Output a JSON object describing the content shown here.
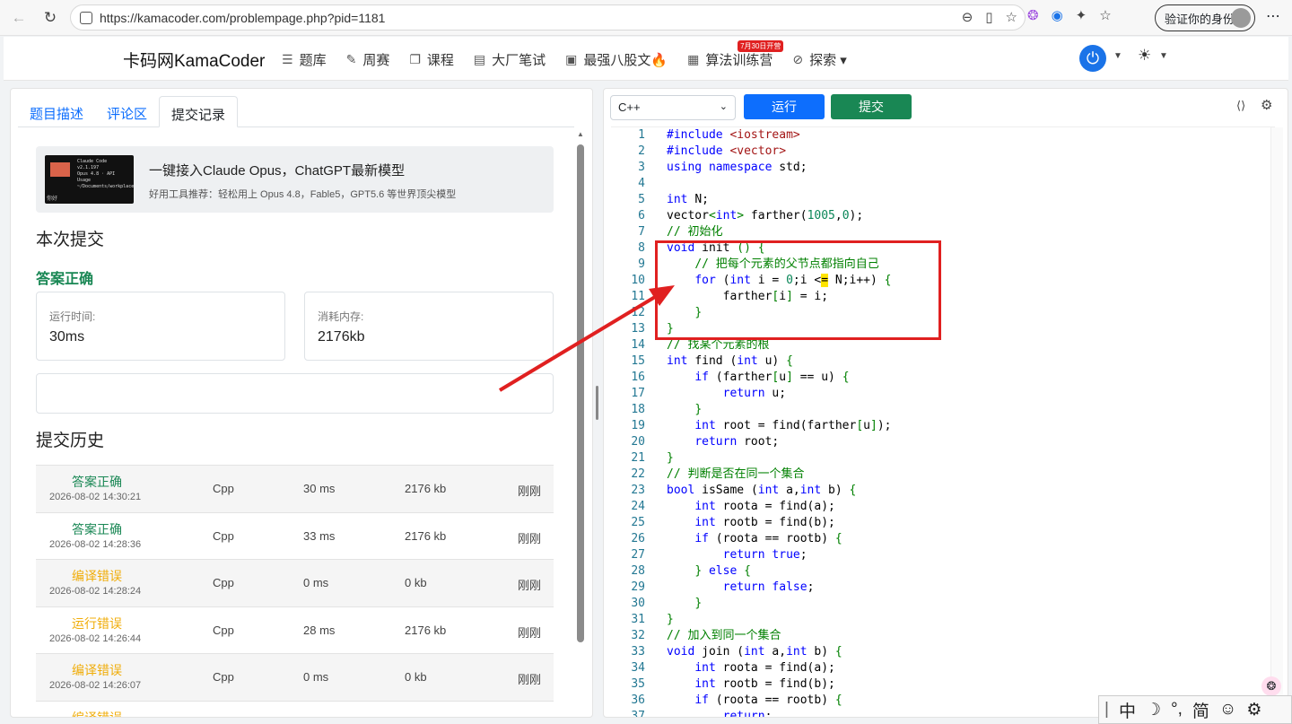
{
  "browser": {
    "url": "https://kamacoder.com/problempage.php?pid=1181",
    "profile_label": "验证你的身份"
  },
  "site": {
    "brand": "卡码网KamaCoder",
    "nav": [
      {
        "icon": "list-icon",
        "glyph": "☰",
        "label": "题库"
      },
      {
        "icon": "pencil-icon",
        "glyph": "✎",
        "label": "周赛"
      },
      {
        "icon": "copy-icon",
        "glyph": "❐",
        "label": "课程"
      },
      {
        "icon": "document-icon",
        "glyph": "▤",
        "label": "大厂笔试"
      },
      {
        "icon": "book-icon",
        "glyph": "▣",
        "label": "最强八股文🔥"
      },
      {
        "icon": "calendar-icon",
        "glyph": "▦",
        "label": "算法训练营",
        "badge": "7月30日开营"
      },
      {
        "icon": "compass-icon",
        "glyph": "⊘",
        "label": "探索 ▾"
      }
    ]
  },
  "left": {
    "tabs": [
      "题目描述",
      "评论区",
      "提交记录"
    ],
    "active_tab": "提交记录",
    "promo": {
      "title": "一键接入Claude Opus，ChatGPT最新模型",
      "subtitle": "好用工具推荐：轻松用上 Opus 4.8，Fable5，GPT5.6 等世界顶尖模型",
      "image_lines": [
        "Claude Code v2.1.197",
        "Opus 4.8 · API Usage",
        "~/Documents/workplace"
      ],
      "image_tag": "你好"
    },
    "current_heading": "本次提交",
    "current_result": "答案正确",
    "runtime_label": "运行时间:",
    "runtime_value": "30ms",
    "memory_label": "消耗内存:",
    "memory_value": "2176kb",
    "history_heading": "提交历史",
    "history": [
      {
        "status": "答案正确",
        "kind": "ok",
        "time": "2026-08-02 14:30:21",
        "lang": "Cpp",
        "runtime": "30 ms",
        "memory": "2176 kb",
        "when": "刚刚"
      },
      {
        "status": "答案正确",
        "kind": "ok",
        "time": "2026-08-02 14:28:36",
        "lang": "Cpp",
        "runtime": "33 ms",
        "memory": "2176 kb",
        "when": "刚刚"
      },
      {
        "status": "编译错误",
        "kind": "warn",
        "time": "2026-08-02 14:28:24",
        "lang": "Cpp",
        "runtime": "0 ms",
        "memory": "0 kb",
        "when": "刚刚"
      },
      {
        "status": "运行错误",
        "kind": "warn",
        "time": "2026-08-02 14:26:44",
        "lang": "Cpp",
        "runtime": "28 ms",
        "memory": "2176 kb",
        "when": "刚刚"
      },
      {
        "status": "编译错误",
        "kind": "warn",
        "time": "2026-08-02 14:26:07",
        "lang": "Cpp",
        "runtime": "0 ms",
        "memory": "0 kb",
        "when": "刚刚"
      },
      {
        "status": "编译错误",
        "kind": "warn",
        "time": "",
        "lang": "",
        "runtime": "",
        "memory": "",
        "when": ""
      }
    ]
  },
  "right": {
    "language": "C++",
    "run_label": "运行",
    "submit_label": "提交",
    "code": [
      [
        [
          "k",
          "#include "
        ],
        [
          "s",
          "<iostream>"
        ]
      ],
      [
        [
          "k",
          "#include "
        ],
        [
          "s",
          "<vector>"
        ]
      ],
      [
        [
          "k",
          "using namespace "
        ],
        [
          "t",
          "std;"
        ]
      ],
      [],
      [
        [
          "k",
          "int "
        ],
        [
          "t",
          "N;"
        ]
      ],
      [
        [
          "t",
          "vector"
        ],
        [
          "b",
          "<"
        ],
        [
          "k",
          "int"
        ],
        [
          "b",
          ">"
        ],
        [
          "t",
          " farther("
        ],
        [
          "n",
          "1005"
        ],
        [
          "t",
          ","
        ],
        [
          "n",
          "0"
        ],
        [
          "t",
          ");"
        ]
      ],
      [
        [
          "c",
          "// 初始化"
        ]
      ],
      [
        [
          "k",
          "void "
        ],
        [
          "t",
          "init "
        ],
        [
          "b",
          "() {"
        ]
      ],
      [
        [
          "t",
          "    "
        ],
        [
          "c",
          "// 把每个元素的父节点都指向自己"
        ]
      ],
      [
        [
          "t",
          "    "
        ],
        [
          "k",
          "for "
        ],
        [
          "t",
          "("
        ],
        [
          "k",
          "int "
        ],
        [
          "t",
          "i = "
        ],
        [
          "n",
          "0"
        ],
        [
          "t",
          ";i <"
        ],
        [
          "h",
          "="
        ],
        [
          "t",
          " N;i++) "
        ],
        [
          "b",
          "{"
        ]
      ],
      [
        [
          "t",
          "        farther"
        ],
        [
          "b",
          "["
        ],
        [
          "t",
          "i"
        ],
        [
          "b",
          "]"
        ],
        [
          "t",
          " = i;"
        ]
      ],
      [
        [
          "t",
          "    "
        ],
        [
          "b",
          "}"
        ]
      ],
      [
        [
          "b",
          "}"
        ]
      ],
      [
        [
          "c",
          "// 找某个元素的根"
        ]
      ],
      [
        [
          "k",
          "int "
        ],
        [
          "t",
          "find "
        ],
        [
          "t",
          "("
        ],
        [
          "k",
          "int "
        ],
        [
          "t",
          "u) "
        ],
        [
          "b",
          "{"
        ]
      ],
      [
        [
          "t",
          "    "
        ],
        [
          "k",
          "if "
        ],
        [
          "t",
          "(farther"
        ],
        [
          "b",
          "["
        ],
        [
          "t",
          "u"
        ],
        [
          "b",
          "]"
        ],
        [
          "t",
          " == u) "
        ],
        [
          "b",
          "{"
        ]
      ],
      [
        [
          "t",
          "        "
        ],
        [
          "k",
          "return "
        ],
        [
          "t",
          "u;"
        ]
      ],
      [
        [
          "t",
          "    "
        ],
        [
          "b",
          "}"
        ]
      ],
      [
        [
          "t",
          "    "
        ],
        [
          "k",
          "int "
        ],
        [
          "t",
          "root = find(farther"
        ],
        [
          "b",
          "["
        ],
        [
          "t",
          "u"
        ],
        [
          "b",
          "]"
        ],
        [
          "t",
          ");"
        ]
      ],
      [
        [
          "t",
          "    "
        ],
        [
          "k",
          "return "
        ],
        [
          "t",
          "root;"
        ]
      ],
      [
        [
          "b",
          "}"
        ]
      ],
      [
        [
          "c",
          "// 判断是否在同一个集合"
        ]
      ],
      [
        [
          "k",
          "bool "
        ],
        [
          "t",
          "isSame "
        ],
        [
          "t",
          "("
        ],
        [
          "k",
          "int "
        ],
        [
          "t",
          "a,"
        ],
        [
          "k",
          "int "
        ],
        [
          "t",
          "b) "
        ],
        [
          "b",
          "{"
        ]
      ],
      [
        [
          "t",
          "    "
        ],
        [
          "k",
          "int "
        ],
        [
          "t",
          "roota = find(a);"
        ]
      ],
      [
        [
          "t",
          "    "
        ],
        [
          "k",
          "int "
        ],
        [
          "t",
          "rootb = find(b);"
        ]
      ],
      [
        [
          "t",
          "    "
        ],
        [
          "k",
          "if "
        ],
        [
          "t",
          "(roota == rootb) "
        ],
        [
          "b",
          "{"
        ]
      ],
      [
        [
          "t",
          "        "
        ],
        [
          "k",
          "return "
        ],
        [
          "k",
          "true"
        ],
        [
          "t",
          ";"
        ]
      ],
      [
        [
          "t",
          "    "
        ],
        [
          "b",
          "}"
        ],
        [
          "t",
          " "
        ],
        [
          "k",
          "else "
        ],
        [
          "b",
          "{"
        ]
      ],
      [
        [
          "t",
          "        "
        ],
        [
          "k",
          "return "
        ],
        [
          "k",
          "false"
        ],
        [
          "t",
          ";"
        ]
      ],
      [
        [
          "t",
          "    "
        ],
        [
          "b",
          "}"
        ]
      ],
      [
        [
          "b",
          "}"
        ]
      ],
      [
        [
          "c",
          "// 加入到同一个集合"
        ]
      ],
      [
        [
          "k",
          "void "
        ],
        [
          "t",
          "join "
        ],
        [
          "t",
          "("
        ],
        [
          "k",
          "int "
        ],
        [
          "t",
          "a,"
        ],
        [
          "k",
          "int "
        ],
        [
          "t",
          "b) "
        ],
        [
          "b",
          "{"
        ]
      ],
      [
        [
          "t",
          "    "
        ],
        [
          "k",
          "int "
        ],
        [
          "t",
          "roota = find(a);"
        ]
      ],
      [
        [
          "t",
          "    "
        ],
        [
          "k",
          "int "
        ],
        [
          "t",
          "rootb = find(b);"
        ]
      ],
      [
        [
          "t",
          "    "
        ],
        [
          "k",
          "if "
        ],
        [
          "t",
          "(roota == rootb) "
        ],
        [
          "b",
          "{"
        ]
      ],
      [
        [
          "t",
          "        "
        ],
        [
          "k",
          "return"
        ],
        [
          "t",
          ";"
        ]
      ]
    ]
  },
  "ime": [
    "中",
    "☽",
    "°,",
    "简",
    "☺",
    "⚙"
  ]
}
